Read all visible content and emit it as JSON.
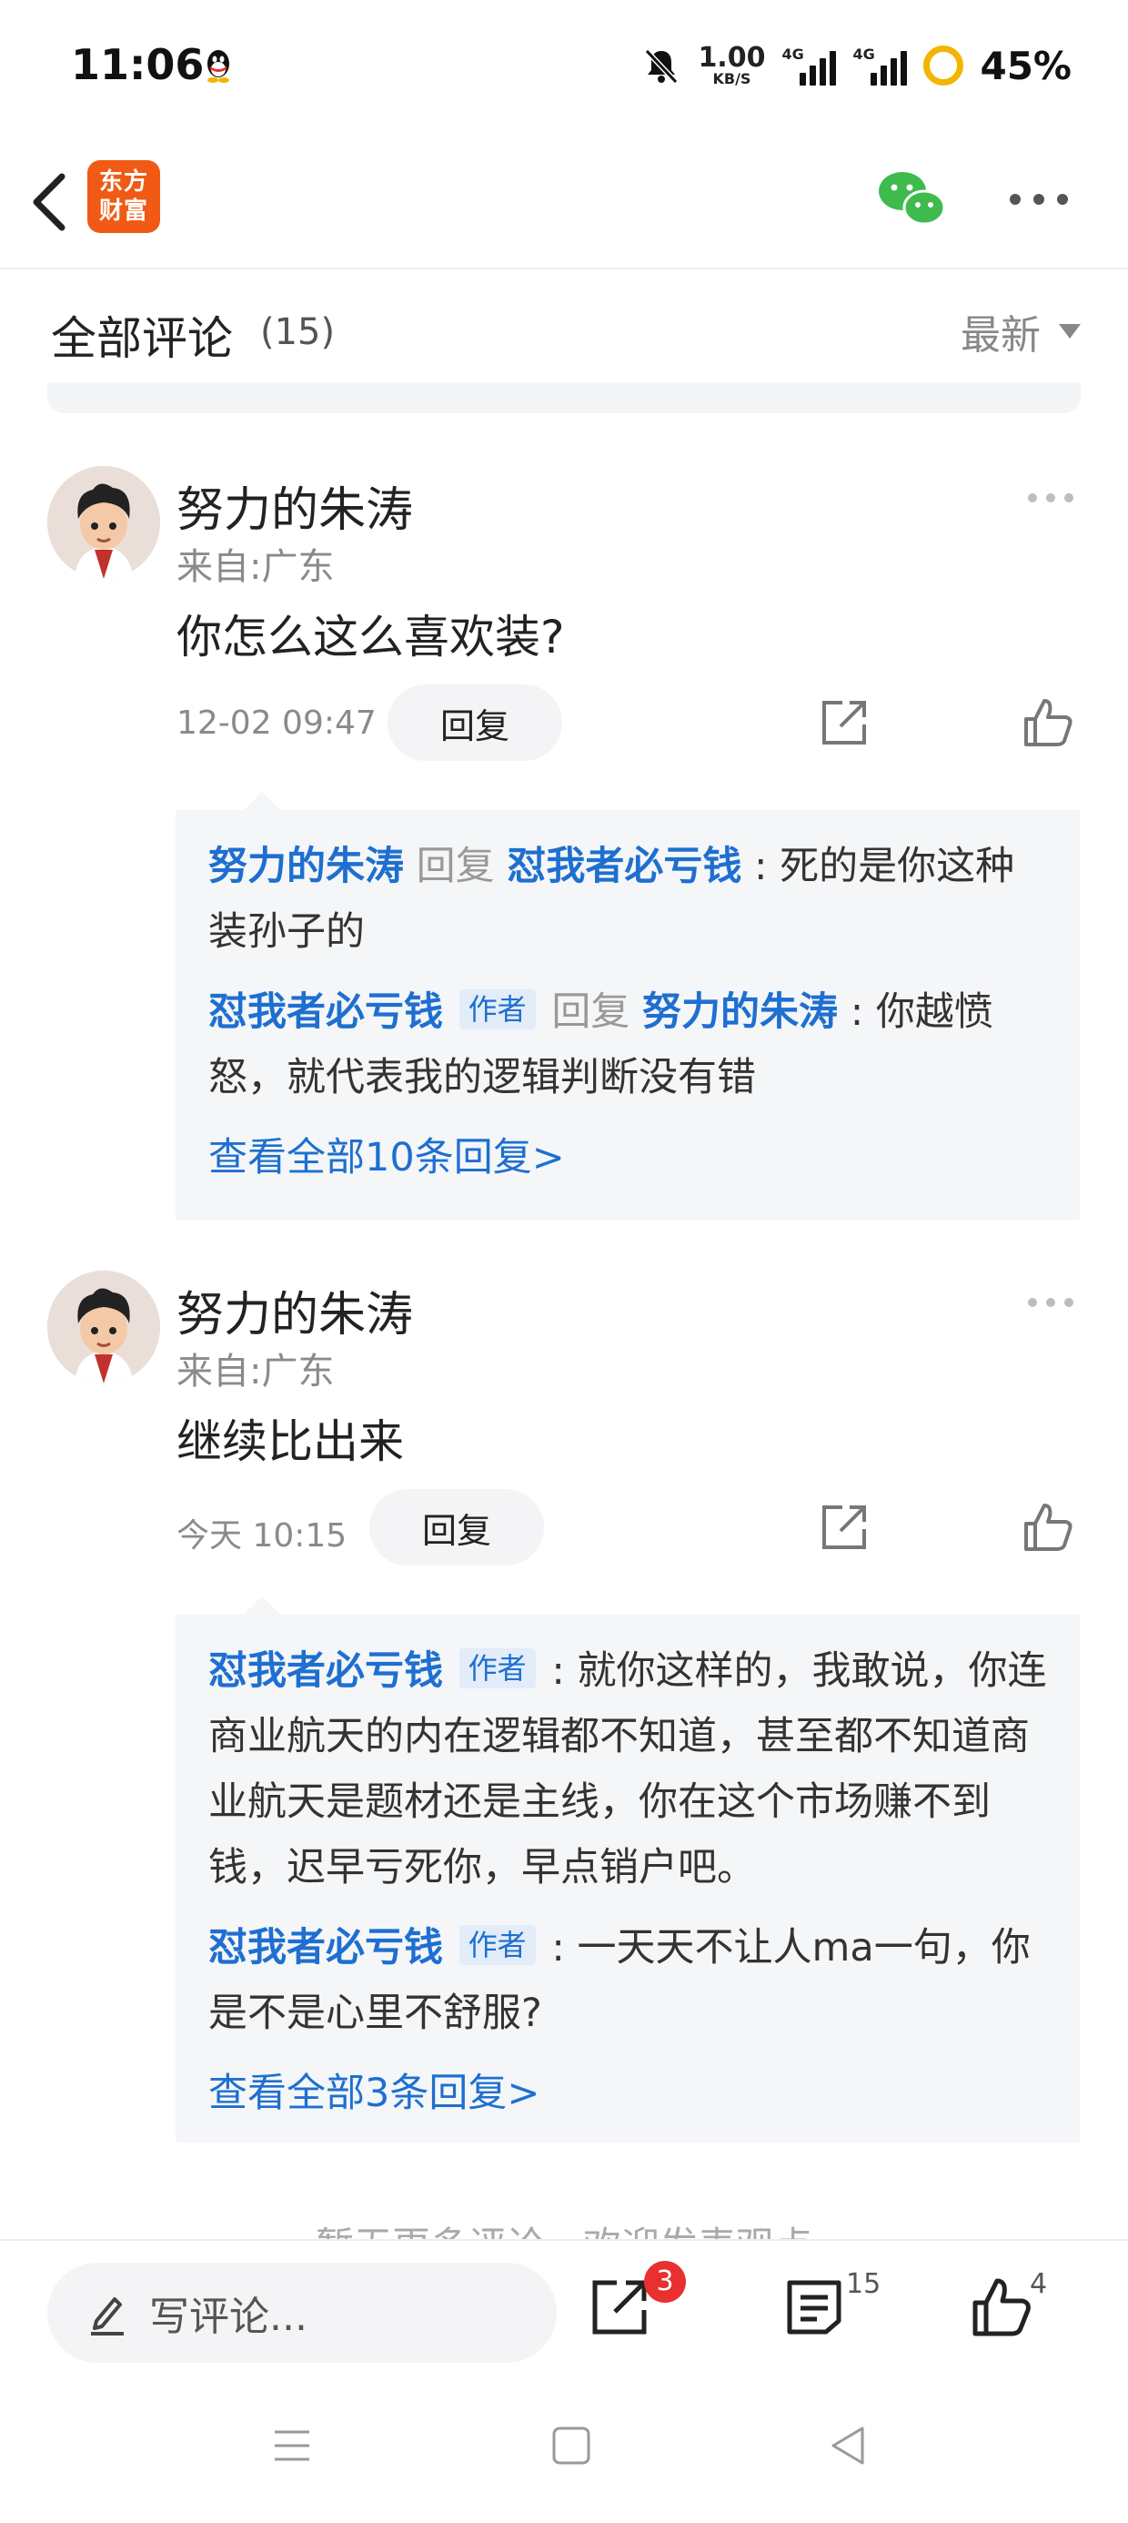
{
  "status_bar": {
    "time": "11:06",
    "net_speed_value": "1.00",
    "net_speed_unit": "KB/S",
    "signal1_tag": "4G",
    "signal2_tag": "4G",
    "battery": "45%"
  },
  "nav": {
    "logo_line1": "东方",
    "logo_line2": "财富"
  },
  "header": {
    "title": "全部评论",
    "count": "(15)",
    "sort_label": "最新"
  },
  "comments": [
    {
      "author": "努力的朱涛",
      "location": "来自:广东",
      "text": "你怎么这么喜欢装?",
      "time": "12-02 09:47",
      "reply_label": "回复",
      "replies": [
        {
          "name": "努力的朱涛",
          "reply_word": "回复",
          "target": "怼我者必亏钱",
          "text": ": 死的是你这种装孙子的"
        },
        {
          "name": "怼我者必亏钱",
          "badge": "作者",
          "reply_word": "回复",
          "target": "努力的朱涛",
          "text": ": 你越愤怒，就代表我的逻辑判断没有错"
        }
      ],
      "view_all": "查看全部10条回复>"
    },
    {
      "author": "努力的朱涛",
      "location": "来自:广东",
      "text": "继续比出来",
      "time": "今天 10:15",
      "reply_label": "回复",
      "replies": [
        {
          "name": "怼我者必亏钱",
          "badge": "作者",
          "text": ": 就你这样的，我敢说，你连商业航天的内在逻辑都不知道，甚至都不知道商业航天是题材还是主线，你在这个市场赚不到钱，迟早亏死你，早点销户吧。"
        },
        {
          "name": "怼我者必亏钱",
          "badge": "作者",
          "text": ": 一天天不让人ma一句，你是不是心里不舒服?"
        }
      ],
      "view_all": "查看全部3条回复>"
    }
  ],
  "footer_note": "暂无更多评论，欢迎发表观点",
  "bottom_bar": {
    "input_placeholder": "写评论...",
    "share_badge": "3",
    "comments_count": "15",
    "likes_count": "4"
  },
  "icons": [
    "qq-icon",
    "mute-icon",
    "back-icon",
    "wechat-icon",
    "more-icon",
    "share-icon",
    "like-icon",
    "pencil-icon",
    "list-icon",
    "menu-icon",
    "home-icon",
    "back-triangle-icon"
  ],
  "colors": {
    "accent": "#1e6fd0",
    "logo": "#f05a14",
    "badge": "#e8302e",
    "reply_bg": "#f4f6f8"
  }
}
